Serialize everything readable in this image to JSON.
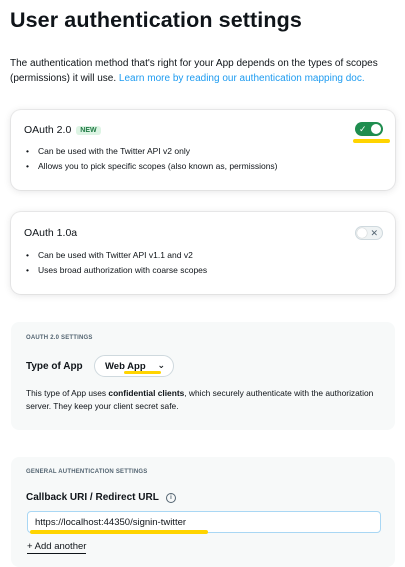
{
  "page": {
    "title": "User authentication settings",
    "intro_text": "The authentication method that's right for your App depends on the types of scopes (permissions) it will use.",
    "intro_link": "Learn more by reading our authentication mapping doc."
  },
  "oauth2": {
    "title": "OAuth 2.0",
    "badge": "NEW",
    "enabled": true,
    "bullets": [
      "Can be used with the Twitter API v2 only",
      "Allows you to pick specific scopes (also known as, permissions)"
    ]
  },
  "oauth1": {
    "title": "OAuth 1.0a",
    "enabled": false,
    "bullets": [
      "Can be used with Twitter API v1.1 and v2",
      "Uses broad authorization with coarse scopes"
    ]
  },
  "oauth2_settings": {
    "section_label": "OAUTH 2.0 SETTINGS",
    "type_label": "Type of App",
    "type_value": "Web App",
    "desc_before": "This type of App uses ",
    "desc_bold": "confidential clients",
    "desc_after": ", which securely authenticate with the authorization server. They keep your client secret safe."
  },
  "general_settings": {
    "section_label": "GENERAL AUTHENTICATION SETTINGS",
    "callback_label": "Callback URI / Redirect URL",
    "callback_value": "https://localhost:44350/signin-twitter",
    "add_another": "+ Add another"
  },
  "colors": {
    "accent_link": "#1d9bf0",
    "toggle_on": "#1f8d4f",
    "highlight": "#ffd400"
  },
  "icons": {
    "toggle_on": "check-icon",
    "toggle_off": "x-icon",
    "select": "chevron-down-icon",
    "info": "info-icon"
  }
}
